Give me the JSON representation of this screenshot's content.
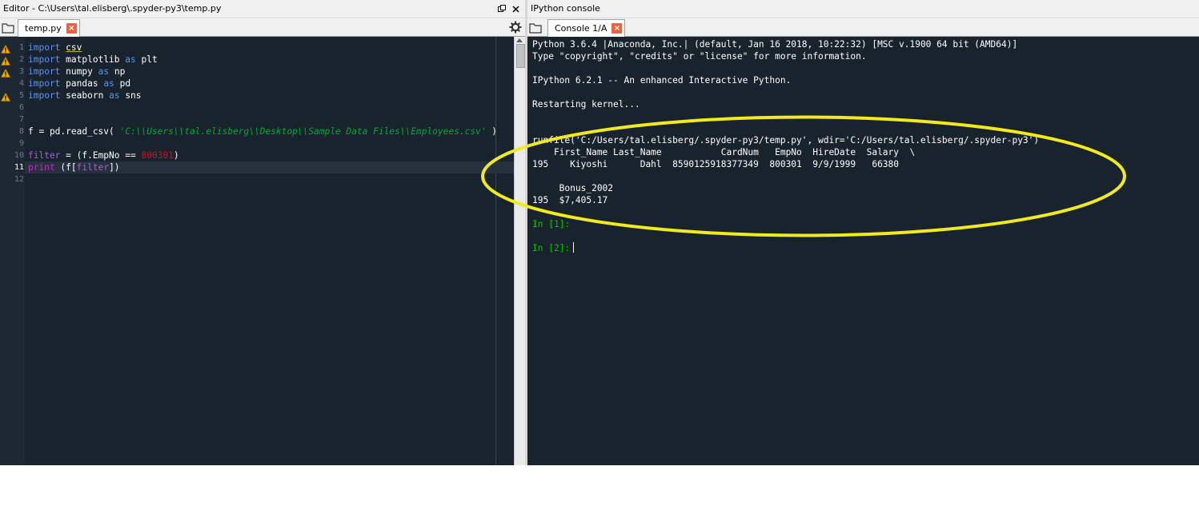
{
  "editor": {
    "title": "Editor - C:\\Users\\tal.elisberg\\.spyder-py3\\temp.py",
    "tab_label": "temp.py",
    "tab_close": "×",
    "lines": [
      {
        "num": "1"
      },
      {
        "num": "2"
      },
      {
        "num": "3"
      },
      {
        "num": "4"
      },
      {
        "num": "5"
      },
      {
        "num": "6"
      },
      {
        "num": "7"
      },
      {
        "num": "8"
      },
      {
        "num": "9"
      },
      {
        "num": "10"
      },
      {
        "num": "11"
      },
      {
        "num": "12"
      }
    ],
    "tokens": {
      "import": "import",
      "as": "as",
      "csv": "csv",
      "matplotlib": "matplotlib",
      "plt": "plt",
      "numpy": "numpy",
      "np": "np",
      "pandas": "pandas",
      "pd": "pd",
      "seaborn": "seaborn",
      "sns": "sns",
      "line8_pre": "f = pd.read_csv( ",
      "line8_str": "'C:\\\\Users\\\\tal.elisberg\\\\Desktop\\\\Sample Data Files\\\\Employees.csv'",
      "line8_post": " )",
      "filter": "filter",
      "line10_mid": " = (f.EmpNo == ",
      "line10_num": "800301",
      "line10_post": ")",
      "print": "print",
      "line11_mid": " (f[",
      "line11_post": "])"
    }
  },
  "console": {
    "title": "IPython console",
    "tab_label": "Console 1/A",
    "tab_close": "×",
    "lines": [
      "Python 3.6.4 |Anaconda, Inc.| (default, Jan 16 2018, 10:22:32) [MSC v.1900 64 bit (AMD64)]",
      "Type \"copyright\", \"credits\" or \"license\" for more information.",
      "IPython 6.2.1 -- An enhanced Interactive Python.",
      "Restarting kernel...",
      "runfile('C:/Users/tal.elisberg/.spyder-py3/temp.py', wdir='C:/Users/tal.elisberg/.spyder-py3')",
      "    First_Name Last_Name           CardNum   EmpNo  HireDate  Salary  \\",
      "195    Kiyoshi      Dahl  8590125918377349  800301  9/9/1999   66380",
      "     Bonus_2002",
      "195  $7,405.17"
    ],
    "prompt1": "In [1]:",
    "prompt2": "In [2]:"
  },
  "colors": {
    "background": "#19232d",
    "keyword": "#5f92f2",
    "string": "#00aa33",
    "number": "#c8102e",
    "builtin": "#c12dc1",
    "prompt": "#00c800",
    "highlight": "#f2ea20"
  }
}
